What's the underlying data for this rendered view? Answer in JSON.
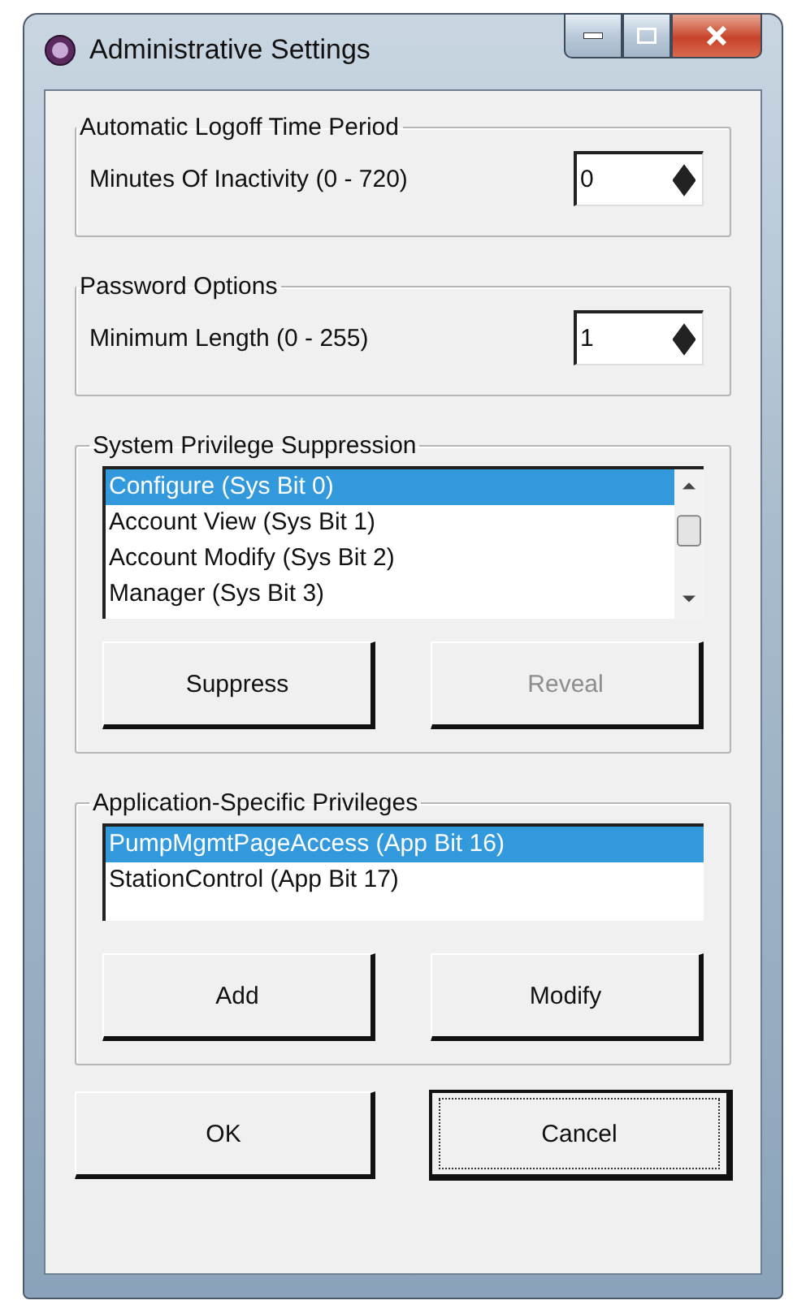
{
  "window": {
    "title": "Administrative Settings"
  },
  "sections": [
    {
      "kind": "spin",
      "legend": "Automatic Logoff Time Period",
      "label": "Minutes Of Inactivity (0 - 720)",
      "value": "0"
    },
    {
      "kind": "spin",
      "legend": "Password Options",
      "label": "Minimum Length (0 - 255)",
      "value": "1"
    },
    {
      "kind": "list",
      "legend": "System Privilege Suppression",
      "scrollbar": true,
      "items": [
        {
          "label": "Configure (Sys Bit 0)",
          "selected": true
        },
        {
          "label": "Account View (Sys Bit 1)",
          "selected": false
        },
        {
          "label": "Account Modify (Sys Bit 2)",
          "selected": false
        },
        {
          "label": "Manager (Sys Bit 3)",
          "selected": false
        }
      ],
      "buttons": [
        {
          "label": "Suppress",
          "disabled": false
        },
        {
          "label": "Reveal",
          "disabled": true
        }
      ]
    },
    {
      "kind": "list",
      "legend": "Application-Specific Privileges",
      "scrollbar": false,
      "items": [
        {
          "label": "PumpMgmtPageAccess (App Bit 16)",
          "selected": true
        },
        {
          "label": "StationControl (App Bit 17)",
          "selected": false
        }
      ],
      "buttons": [
        {
          "label": "Add",
          "disabled": false
        },
        {
          "label": "Modify",
          "disabled": false
        }
      ]
    }
  ],
  "buttons": [
    {
      "label": "OK",
      "default": false
    },
    {
      "label": "Cancel",
      "default": true
    }
  ]
}
